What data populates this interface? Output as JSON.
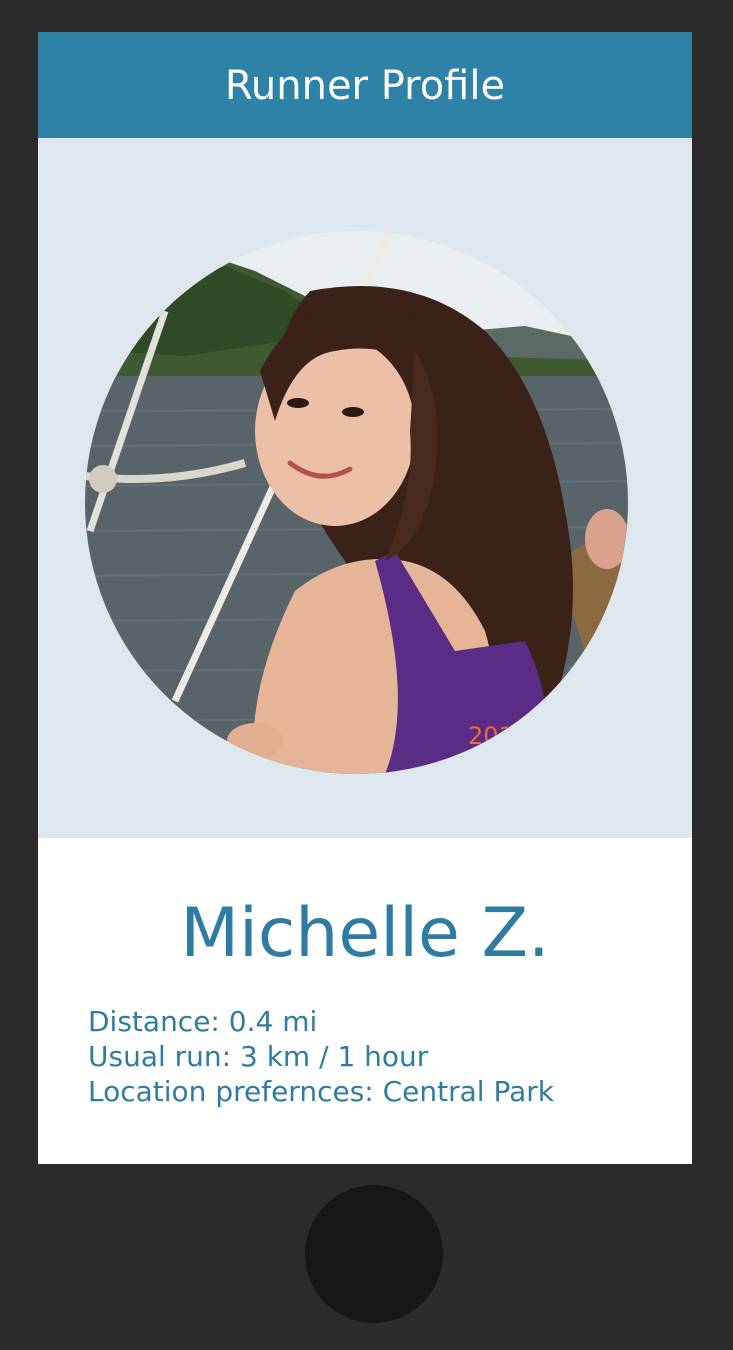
{
  "header": {
    "title": "Runner Profile"
  },
  "profile": {
    "name": "Michelle Z.",
    "photo_icon": "runner-photo",
    "details": {
      "distance": "Distance: 0.4 mi",
      "usual_run": "Usual run: 3 km / 1 hour",
      "location": "Location prefernces: Central Park"
    }
  },
  "colors": {
    "accent": "#2e82a6",
    "panel": "#dde7ed",
    "text": "#2e7ca2",
    "frame": "#2b2b2b"
  }
}
